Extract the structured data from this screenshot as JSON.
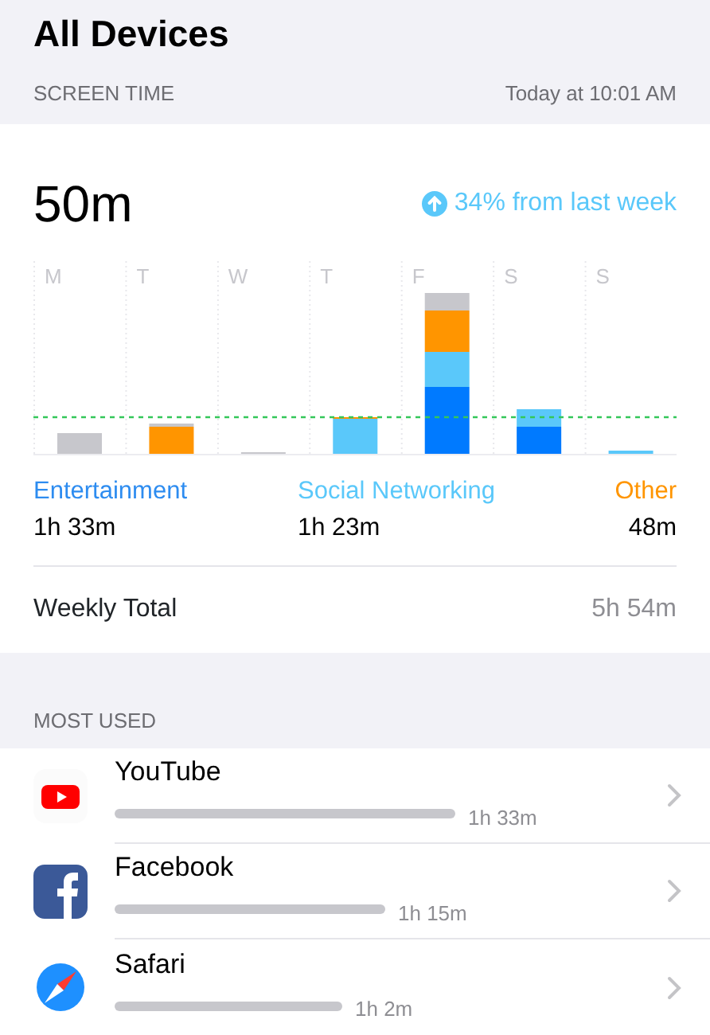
{
  "title": "All Devices",
  "screen_time": {
    "heading": "SCREEN TIME",
    "updated": "Today at 10:01 AM",
    "total": "50m",
    "change": "34% from last week"
  },
  "chart": {
    "days": [
      "M",
      "T",
      "W",
      "T",
      "F",
      "S",
      "S"
    ]
  },
  "legend": [
    {
      "label": "Entertainment",
      "value": "1h 33m",
      "color": "#2d8cf0"
    },
    {
      "label": "Social Networking",
      "value": "1h 23m",
      "color": "#5ac8fa"
    },
    {
      "label": "Other",
      "value": "48m",
      "color": "#ff9500"
    }
  ],
  "weekly_total": {
    "label": "Weekly Total",
    "value": "5h 54m"
  },
  "most_used": {
    "heading": "MOST USED",
    "apps": [
      {
        "kind": "youtube",
        "name": "YouTube",
        "time": "1h 33m"
      },
      {
        "kind": "facebook",
        "name": "Facebook",
        "time": "1h 15m"
      },
      {
        "kind": "safari",
        "name": "Safari",
        "time": "1h 2m"
      }
    ]
  }
}
